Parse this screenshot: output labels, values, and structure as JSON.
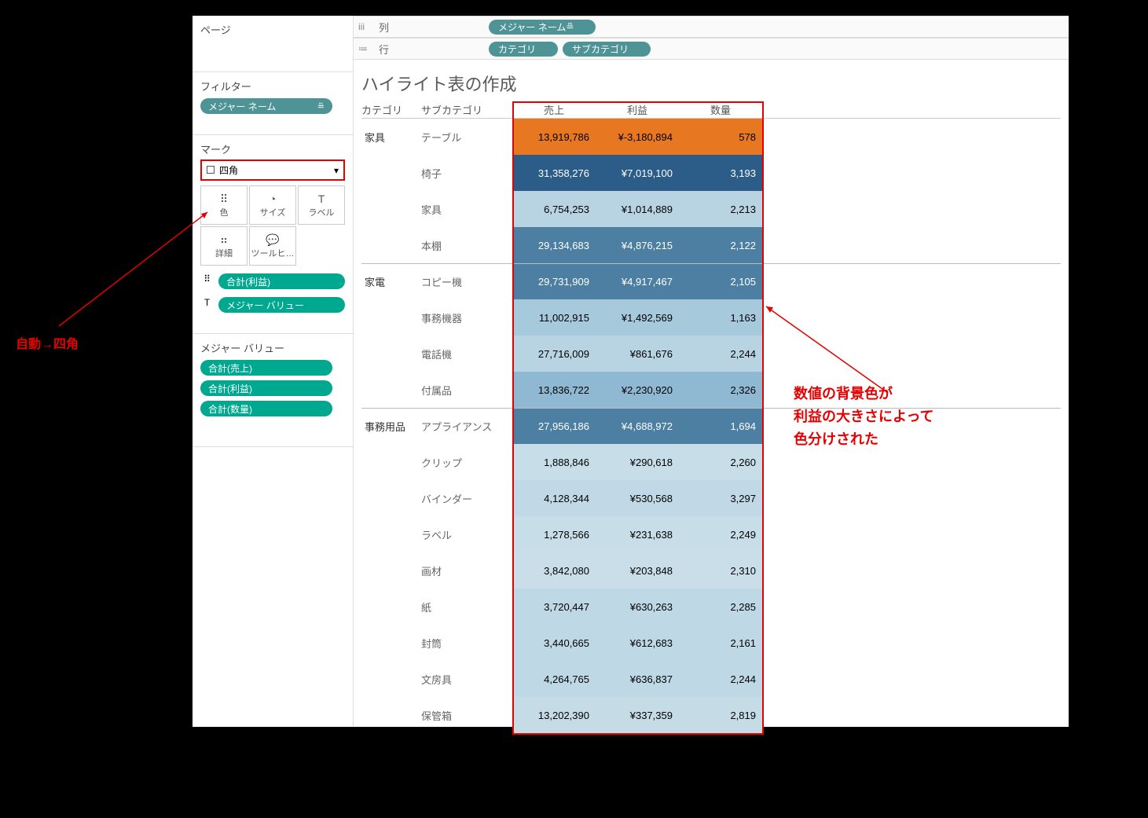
{
  "left": {
    "pages": "ページ",
    "filters": "フィルター",
    "filter_pill": "メジャー ネーム",
    "marks": "マーク",
    "mark_type": "四角",
    "btn_color": "色",
    "btn_size": "サイズ",
    "btn_label": "ラベル",
    "btn_detail": "詳細",
    "btn_tooltip": "ツールヒ…",
    "enc1": "合計(利益)",
    "enc2": "メジャー バリュー",
    "mvalues_title": "メジャー バリュー",
    "mv1": "合計(売上)",
    "mv2": "合計(利益)",
    "mv3": "合計(数量)"
  },
  "shelves": {
    "col_icon": "iii",
    "col_label": "列",
    "col_pill": "メジャー ネーム",
    "row_icon": "≔",
    "row_label": "行",
    "row_pill1": "カテゴリ",
    "row_pill2": "サブカテゴリ"
  },
  "viz": {
    "title": "ハイライト表の作成",
    "h_cat": "カテゴリ",
    "h_sub": "サブカテゴリ",
    "h_m1": "売上",
    "h_m2": "利益",
    "h_m3": "数量"
  },
  "annotations": {
    "leftA": "自動→四角",
    "rightA": "数値の背景色が",
    "rightB": "利益の大きさによって",
    "rightC": "色分けされた"
  },
  "chart_data": {
    "type": "table",
    "categories": [
      "家具",
      "家電",
      "事務用品"
    ],
    "subcategories_per_category": {
      "家具": [
        "テーブル",
        "椅子",
        "家具",
        "本棚"
      ],
      "家電": [
        "コピー機",
        "事務機器",
        "電話機",
        "付属品"
      ],
      "事務用品": [
        "アプライアンス",
        "クリップ",
        "バインダー",
        "ラベル",
        "画材",
        "紙",
        "封筒",
        "文房具",
        "保管箱"
      ]
    },
    "measures": [
      "売上",
      "利益",
      "数量"
    ],
    "rows": [
      {
        "cat": "家具",
        "sub": "テーブル",
        "sales": "13,919,786",
        "profit": "¥-3,180,894",
        "qty": "578",
        "color": "#e87722",
        "txt": "#000"
      },
      {
        "cat": "家具",
        "sub": "椅子",
        "sales": "31,358,276",
        "profit": "¥7,019,100",
        "qty": "3,193",
        "color": "#2b5d88",
        "txt": "#fff"
      },
      {
        "cat": "家具",
        "sub": "家具",
        "sales": "6,754,253",
        "profit": "¥1,014,889",
        "qty": "2,213",
        "color": "#b8d4e3",
        "txt": "#000"
      },
      {
        "cat": "家具",
        "sub": "本棚",
        "sales": "29,134,683",
        "profit": "¥4,876,215",
        "qty": "2,122",
        "color": "#4d7fa3",
        "txt": "#fff"
      },
      {
        "cat": "家電",
        "sub": "コピー機",
        "sales": "29,731,909",
        "profit": "¥4,917,467",
        "qty": "2,105",
        "color": "#4d7fa3",
        "txt": "#fff"
      },
      {
        "cat": "家電",
        "sub": "事務機器",
        "sales": "11,002,915",
        "profit": "¥1,492,569",
        "qty": "1,163",
        "color": "#a6c9dc",
        "txt": "#000"
      },
      {
        "cat": "家電",
        "sub": "電話機",
        "sales": "27,716,009",
        "profit": "¥861,676",
        "qty": "2,244",
        "color": "#b8d4e3",
        "txt": "#000"
      },
      {
        "cat": "家電",
        "sub": "付属品",
        "sales": "13,836,722",
        "profit": "¥2,230,920",
        "qty": "2,326",
        "color": "#8fb9d2",
        "txt": "#000"
      },
      {
        "cat": "事務用品",
        "sub": "アプライアンス",
        "sales": "27,956,186",
        "profit": "¥4,688,972",
        "qty": "1,694",
        "color": "#4d7fa3",
        "txt": "#fff"
      },
      {
        "cat": "事務用品",
        "sub": "クリップ",
        "sales": "1,888,846",
        "profit": "¥290,618",
        "qty": "2,260",
        "color": "#c7dde8",
        "txt": "#000"
      },
      {
        "cat": "事務用品",
        "sub": "バインダー",
        "sales": "4,128,344",
        "profit": "¥530,568",
        "qty": "3,297",
        "color": "#c1d9e6",
        "txt": "#000"
      },
      {
        "cat": "事務用品",
        "sub": "ラベル",
        "sales": "1,278,566",
        "profit": "¥231,638",
        "qty": "2,249",
        "color": "#c7dde8",
        "txt": "#000"
      },
      {
        "cat": "事務用品",
        "sub": "画材",
        "sales": "3,842,080",
        "profit": "¥203,848",
        "qty": "2,310",
        "color": "#c9dee9",
        "txt": "#000"
      },
      {
        "cat": "事務用品",
        "sub": "紙",
        "sales": "3,720,447",
        "profit": "¥630,263",
        "qty": "2,285",
        "color": "#bfd8e5",
        "txt": "#000"
      },
      {
        "cat": "事務用品",
        "sub": "封筒",
        "sales": "3,440,665",
        "profit": "¥612,683",
        "qty": "2,161",
        "color": "#bfd8e5",
        "txt": "#000"
      },
      {
        "cat": "事務用品",
        "sub": "文房具",
        "sales": "4,264,765",
        "profit": "¥636,837",
        "qty": "2,244",
        "color": "#bfd8e5",
        "txt": "#000"
      },
      {
        "cat": "事務用品",
        "sub": "保管箱",
        "sales": "13,202,390",
        "profit": "¥337,359",
        "qty": "2,819",
        "color": "#c5dce7",
        "txt": "#000"
      }
    ]
  }
}
